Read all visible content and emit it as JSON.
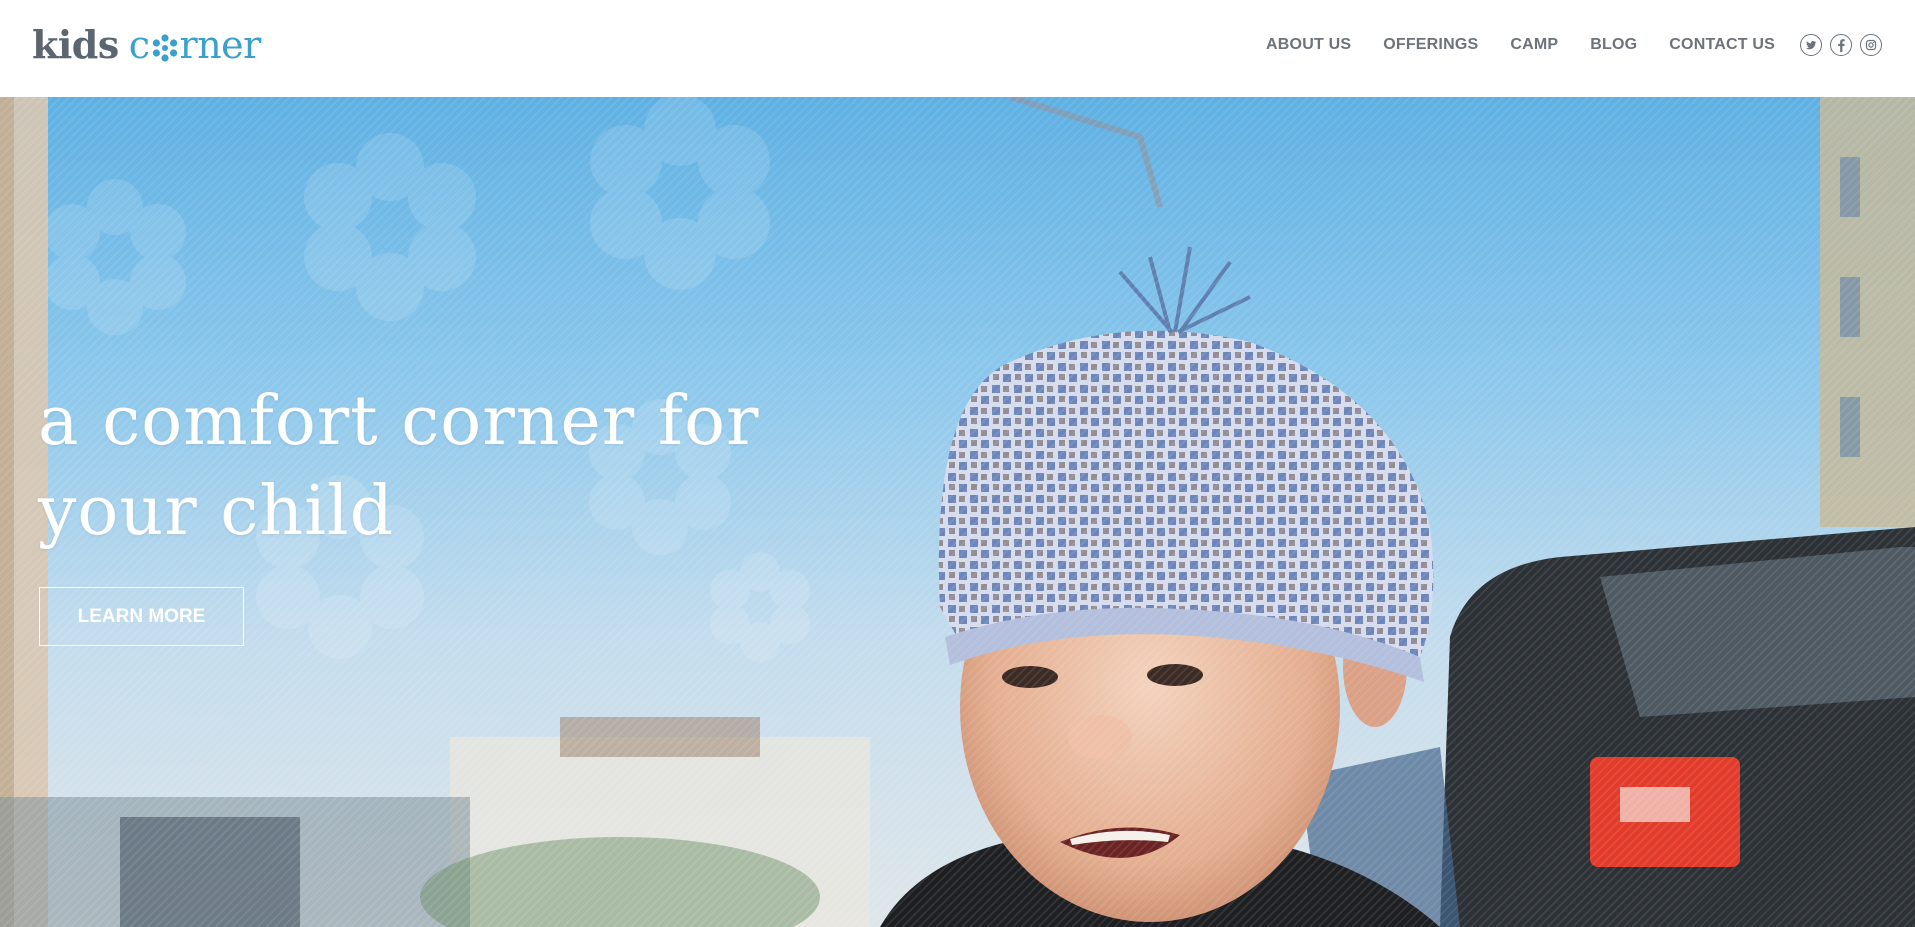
{
  "logo": {
    "part1": "kids",
    "part2_c": "c",
    "part2_rest": "rner",
    "flower_icon": "flower-icon"
  },
  "nav": {
    "items": [
      {
        "label": "ABOUT US"
      },
      {
        "label": "OFFERINGS"
      },
      {
        "label": "CAMP"
      },
      {
        "label": "BLOG"
      },
      {
        "label": "CONTACT US"
      }
    ]
  },
  "social": [
    {
      "icon": "twitter-icon",
      "glyph": "t"
    },
    {
      "icon": "facebook-icon",
      "glyph": "f"
    },
    {
      "icon": "instagram-icon",
      "glyph": "◎"
    }
  ],
  "hero": {
    "headline": "a comfort corner for your child",
    "button": "LEARN MORE"
  },
  "colors": {
    "brand_blue": "#3aa0cd",
    "logo_gray": "#5b6670",
    "nav_gray": "#6c737a"
  }
}
